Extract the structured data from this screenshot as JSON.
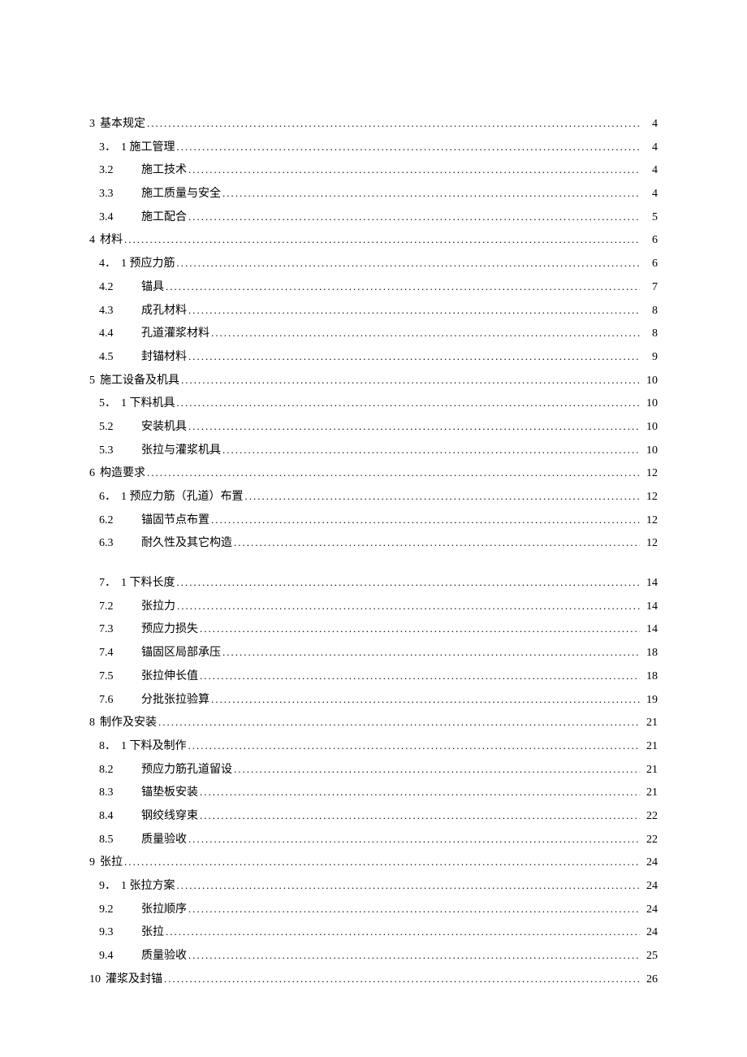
{
  "toc": [
    {
      "level": 1,
      "num": "3",
      "title": "基本规定",
      "page": "4"
    },
    {
      "level": 2,
      "num": "3．",
      "title": "1 施工管理",
      "page": "4",
      "style": "first"
    },
    {
      "level": 2,
      "num": "3.2",
      "title": "施工技术",
      "page": "4",
      "style": "sub"
    },
    {
      "level": 2,
      "num": "3.3",
      "title": "施工质量与安全",
      "page": "4",
      "style": "sub"
    },
    {
      "level": 2,
      "num": "3.4",
      "title": "施工配合",
      "page": "5",
      "style": "sub"
    },
    {
      "level": 1,
      "num": "4",
      "title": "材料",
      "page": "6"
    },
    {
      "level": 2,
      "num": "4．",
      "title": "1 预应力筋",
      "page": "6",
      "style": "first"
    },
    {
      "level": 2,
      "num": "4.2",
      "title": "锚具",
      "page": "7",
      "style": "sub"
    },
    {
      "level": 2,
      "num": "4.3",
      "title": "成孔材料",
      "page": "8",
      "style": "sub"
    },
    {
      "level": 2,
      "num": "4.4",
      "title": "孔道灌浆材料",
      "page": "8",
      "style": "sub"
    },
    {
      "level": 2,
      "num": "4.5",
      "title": "封锚材料",
      "page": "9",
      "style": "sub"
    },
    {
      "level": 1,
      "num": "5",
      "title": "施工设备及机具",
      "page": "10"
    },
    {
      "level": 2,
      "num": "5．",
      "title": "1 下料机具",
      "page": "10",
      "style": "first"
    },
    {
      "level": 2,
      "num": "5.2",
      "title": "安装机具",
      "page": "10",
      "style": "sub"
    },
    {
      "level": 2,
      "num": "5.3",
      "title": "张拉与灌浆机具",
      "page": "10",
      "style": "sub"
    },
    {
      "level": 1,
      "num": "6",
      "title": "构造要求",
      "page": "12"
    },
    {
      "level": 2,
      "num": "6．",
      "title": "1 预应力筋（孔道）布置",
      "page": "12",
      "style": "first"
    },
    {
      "level": 2,
      "num": "6.2",
      "title": "锚固节点布置",
      "page": "12",
      "style": "sub"
    },
    {
      "level": 2,
      "num": "6.3",
      "title": "耐久性及其它构造",
      "page": "12",
      "style": "sub"
    },
    {
      "level": 0,
      "num": "",
      "title": "",
      "page": "",
      "style": "blank"
    },
    {
      "level": 2,
      "num": "7．",
      "title": "1 下料长度",
      "page": "14",
      "style": "first"
    },
    {
      "level": 2,
      "num": "7.2",
      "title": "张拉力",
      "page": "14",
      "style": "sub"
    },
    {
      "level": 2,
      "num": "7.3",
      "title": "预应力损失",
      "page": "14",
      "style": "sub"
    },
    {
      "level": 2,
      "num": "7.4",
      "title": "锚固区局部承压",
      "page": "18",
      "style": "sub"
    },
    {
      "level": 2,
      "num": "7.5",
      "title": "张拉伸长值",
      "page": "18",
      "style": "sub"
    },
    {
      "level": 2,
      "num": "7.6",
      "title": "分批张拉验算",
      "page": "19",
      "style": "sub"
    },
    {
      "level": 1,
      "num": "8",
      "title": "制作及安装",
      "page": "21"
    },
    {
      "level": 2,
      "num": "8．",
      "title": "1 下料及制作",
      "page": "21",
      "style": "first"
    },
    {
      "level": 2,
      "num": "8.2",
      "title": "预应力筋孔道留设",
      "page": "21",
      "style": "sub"
    },
    {
      "level": 2,
      "num": "8.3",
      "title": "锚垫板安装",
      "page": "21",
      "style": "sub"
    },
    {
      "level": 2,
      "num": "8.4",
      "title": "钢绞线穿束",
      "page": "22",
      "style": "sub"
    },
    {
      "level": 2,
      "num": "8.5",
      "title": "质量验收",
      "page": "22",
      "style": "sub"
    },
    {
      "level": 1,
      "num": "9",
      "title": "张拉",
      "page": "24"
    },
    {
      "level": 2,
      "num": "9．",
      "title": "1 张拉方案",
      "page": "24",
      "style": "first"
    },
    {
      "level": 2,
      "num": "9.2",
      "title": "张拉顺序",
      "page": "24",
      "style": "sub"
    },
    {
      "level": 2,
      "num": "9.3",
      "title": "张拉",
      "page": "24",
      "style": "sub"
    },
    {
      "level": 2,
      "num": "9.4",
      "title": "质量验收",
      "page": "25",
      "style": "sub"
    },
    {
      "level": 1,
      "num": "10",
      "title": "灌浆及封锚",
      "page": "26"
    }
  ]
}
